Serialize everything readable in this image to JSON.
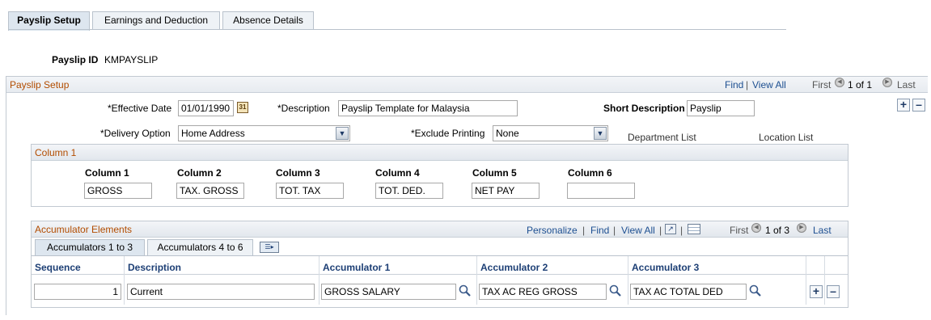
{
  "tabs": [
    {
      "label": "Payslip Setup"
    },
    {
      "label": "Earnings and Deduction"
    },
    {
      "label": "Absence Details"
    }
  ],
  "payslip_id": {
    "label": "Payslip ID",
    "value": "KMPAYSLIP"
  },
  "setup": {
    "title": "Payslip Setup",
    "find": "Find",
    "view_all": "View All",
    "first": "First",
    "count": "1 of 1",
    "last": "Last",
    "effective_date": {
      "label": "*Effective Date",
      "value": "01/01/1990"
    },
    "description": {
      "label": "*Description",
      "value": "Payslip Template for Malaysia"
    },
    "short_description": {
      "label": "Short Description",
      "value": "Payslip"
    },
    "delivery_option": {
      "label": "*Delivery Option",
      "value": "Home Address"
    },
    "exclude_printing": {
      "label": "*Exclude Printing",
      "value": "None"
    },
    "department_list": "Department List",
    "location_list": "Location List"
  },
  "column_group": {
    "title": "Column 1",
    "columns": [
      {
        "label": "Column 1",
        "value": "GROSS"
      },
      {
        "label": "Column 2",
        "value": "TAX. GROSS"
      },
      {
        "label": "Column 3",
        "value": "TOT. TAX"
      },
      {
        "label": "Column 4",
        "value": "TOT. DED."
      },
      {
        "label": "Column 5",
        "value": "NET PAY"
      },
      {
        "label": "Column 6",
        "value": ""
      }
    ]
  },
  "accumulators": {
    "title": "Accumulator Elements",
    "personalize": "Personalize",
    "find": "Find",
    "view_all": "View All",
    "first": "First",
    "count": "1 of 3",
    "last": "Last",
    "subtabs": [
      {
        "label": "Accumulators 1 to 3"
      },
      {
        "label": "Accumulators 4 to 6"
      }
    ],
    "headers": {
      "sequence": "Sequence",
      "description": "Description",
      "acc1": "Accumulator 1",
      "acc2": "Accumulator 2",
      "acc3": "Accumulator 3"
    },
    "row": {
      "sequence": "1",
      "description": "Current",
      "acc1": "GROSS SALARY",
      "acc2": "TAX AC REG GROSS",
      "acc3": "TAX AC TOTAL DED"
    }
  },
  "colors": {
    "section_title": "#b24c00",
    "link": "#1d4f91",
    "grid_header": "#1d3f75"
  }
}
